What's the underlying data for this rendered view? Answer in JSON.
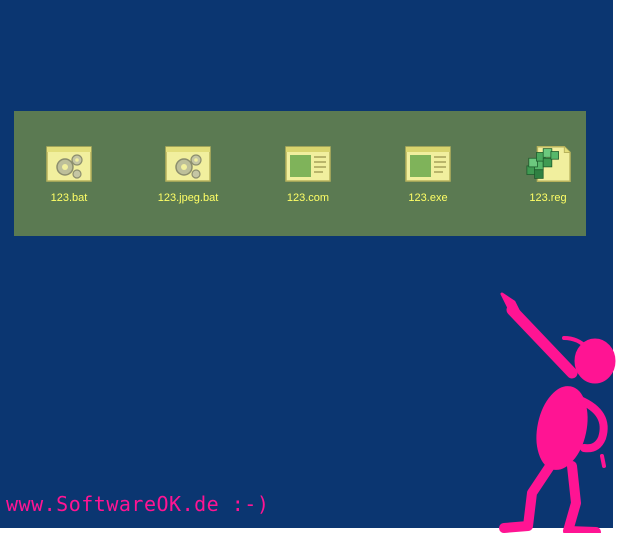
{
  "desktop": {
    "icons": [
      {
        "label": "123.bat",
        "icon": "batch-file-icon"
      },
      {
        "label": "123.jpeg.bat",
        "icon": "batch-file-icon"
      },
      {
        "label": "123.com",
        "icon": "application-window-icon"
      },
      {
        "label": "123.exe",
        "icon": "application-window-icon"
      },
      {
        "label": "123.reg",
        "icon": "registry-file-icon"
      }
    ]
  },
  "watermark": {
    "text": "www.SoftwareOK.de :-)"
  },
  "colors": {
    "desktop_background": "#0b3671",
    "selection_band": "#5b7a52",
    "icon_label": "#ffff66",
    "watermark": "#ff1493"
  }
}
